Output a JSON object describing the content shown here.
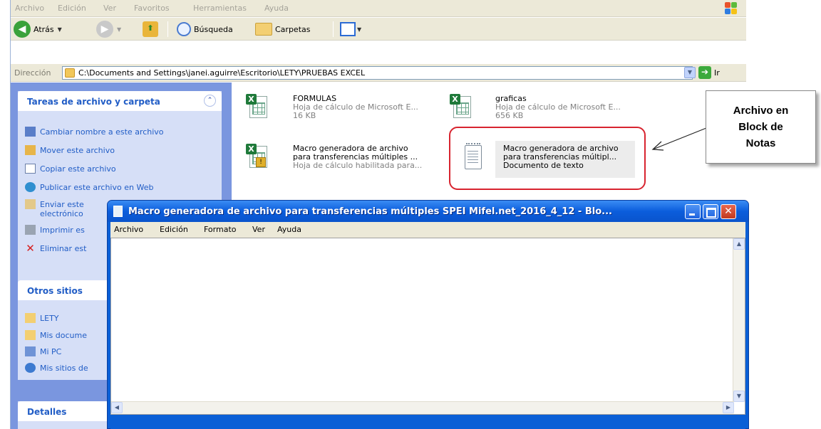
{
  "explorer": {
    "menu": [
      "Archivo",
      "Edición",
      "Ver",
      "Favoritos",
      "Herramientas",
      "Ayuda"
    ],
    "toolbar": {
      "back_label": "Atrás",
      "search_label": "Búsqueda",
      "folders_label": "Carpetas"
    },
    "address": {
      "label": "Dirección",
      "path": "C:\\Documents and Settings\\janei.aguirre\\Escritorio\\LETY\\PRUEBAS EXCEL",
      "go_label": "Ir"
    },
    "tasks_panel": {
      "title": "Tareas de archivo y carpeta",
      "items": [
        "Cambiar nombre a este archivo",
        "Mover este archivo",
        "Copiar este archivo",
        "Publicar este archivo en Web",
        "Enviar este",
        "electrónico",
        "Imprimir es",
        "Eliminar est"
      ]
    },
    "places_panel": {
      "title": "Otros sitios",
      "items": [
        "LETY",
        "Mis docume",
        "Mi PC",
        "Mis sitios de"
      ]
    },
    "details_panel": {
      "title": "Detalles"
    },
    "files": [
      {
        "name": "FORMULAS",
        "type": "Hoja de cálculo de Microsoft E...",
        "size": "16 KB"
      },
      {
        "name": "graficas",
        "type": "Hoja de cálculo de Microsoft E...",
        "size": "656 KB"
      },
      {
        "name": "Macro generadora de archivo",
        "name2": "para transferencias múltiples ...",
        "type": "Hoja de cálculo habilitada para..."
      },
      {
        "name": "Macro generadora de archivo",
        "name2": "para transferencias múltipl...",
        "type": "Documento de texto"
      }
    ]
  },
  "annotation": {
    "line1": "Archivo en",
    "line2": "Block de",
    "line3": "Notas",
    "highlight_color": "#d8242f"
  },
  "notepad": {
    "title": "Macro generadora de archivo para transferencias múltiples SPEI Mifel.net_2016_4_12 - Blo...",
    "menu": [
      "Archivo",
      "Edición",
      "Formato",
      "Ver",
      "Ayuda"
    ],
    "content": ""
  }
}
